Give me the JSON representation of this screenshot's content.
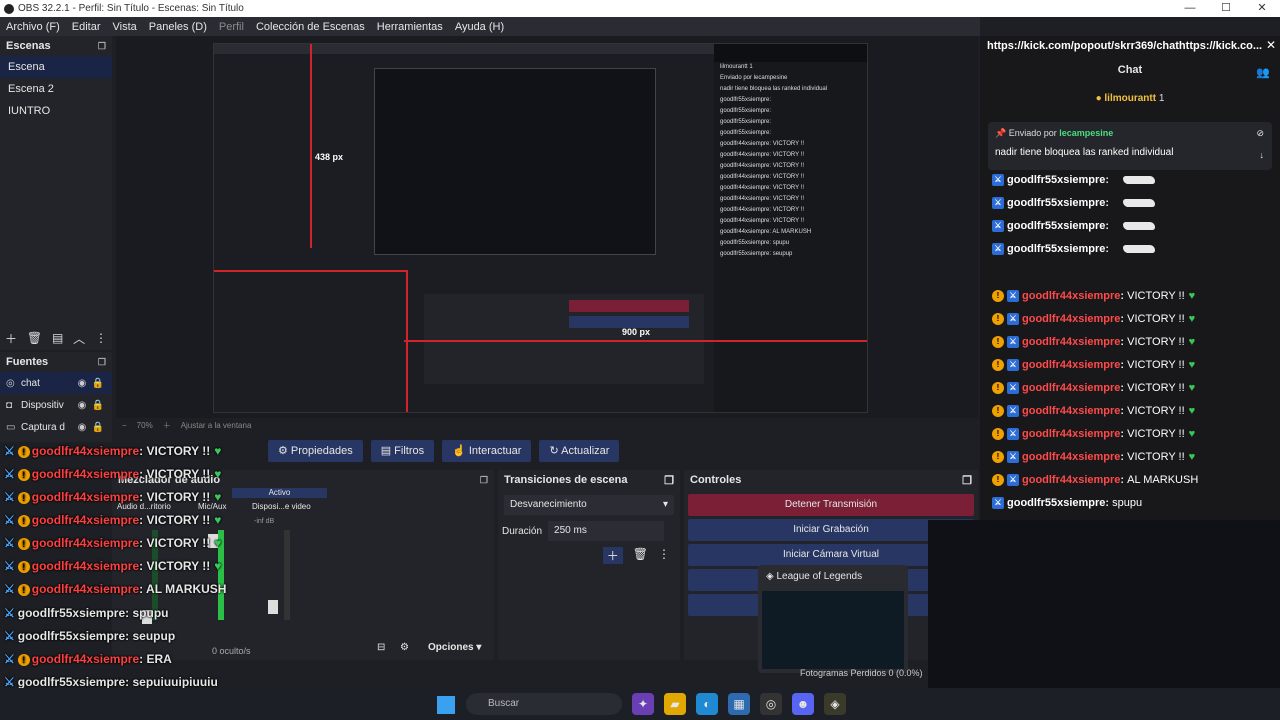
{
  "window": {
    "title": "OBS 32.2.1 - Perfil: Sin Título - Escenas: Sin Título",
    "min": "—",
    "max": "☐",
    "close": "✕"
  },
  "menu": [
    "Archivo (F)",
    "Editar",
    "Vista",
    "Paneles (D)",
    "Perfil",
    "Colección de Escenas",
    "Herramientas",
    "Ayuda (H)"
  ],
  "scenes": {
    "title": "Escenas",
    "items": [
      "Escena",
      "Escena 2",
      "IUNTRO"
    ]
  },
  "sources": {
    "title": "Fuentes",
    "items": [
      {
        "icon": "chat-icon",
        "name": "chat"
      },
      {
        "icon": "camera-icon",
        "name": "Dispositiv"
      },
      {
        "icon": "capture-icon",
        "name": "Captura d"
      }
    ]
  },
  "preview": {
    "label_438": "438 px",
    "label_900": "900 px",
    "zoom": "70%",
    "fit": "Ajustar a la ventana"
  },
  "inner_chat_lines": [
    "lilmourantt 1",
    "Enviado por lecampesine",
    "nadir tiene bloquea las ranked individual",
    "goodlfr55xsiempre:",
    "goodlfr55xsiempre:",
    "goodlfr55xsiempre:",
    "goodlfr55xsiempre:",
    "goodlfr44xsiempre: VICTORY !!",
    "goodlfr44xsiempre: VICTORY !!",
    "goodlfr44xsiempre: VICTORY !!",
    "goodlfr44xsiempre: VICTORY !!",
    "goodlfr44xsiempre: VICTORY !!",
    "goodlfr44xsiempre: VICTORY !!",
    "goodlfr44xsiempre: VICTORY !!",
    "goodlfr44xsiempre: VICTORY !!",
    "goodlfr44xsiempre: AL MARKUSH",
    "goodlfr55xsiempre: spupu",
    "goodlfr55xsiempre: seupup"
  ],
  "toolbar": {
    "properties": "Propiedades",
    "filters": "Filtros",
    "interact": "Interactuar",
    "update": "Actualizar"
  },
  "mixer": {
    "title": "Mezclador de audio",
    "active": "Activo",
    "ch1": "Audio d...ritorio",
    "ch2": "Mic/Aux",
    "ch3": "Disposi...e video",
    "inf": "-inf dB",
    "hidden": "0 oculto/s",
    "options": "Opciones"
  },
  "transitions": {
    "title": "Transiciones de escena",
    "selected": "Desvanecimiento",
    "duration_label": "Duración",
    "duration": "250 ms"
  },
  "controls": {
    "title": "Controles",
    "stop_stream": "Detener Transmisión",
    "start_rec": "Iniciar Grabación",
    "virtual_cam": "Iniciar Cámara Virtual"
  },
  "popup": {
    "title": "League of Legends"
  },
  "frames": "Fotogramas Perdidos 0 (0.0%)",
  "overlay_chat": [
    {
      "user": "goodlfr44xsiempre",
      "msg": "VICTORY !!",
      "red": true,
      "heart": true,
      "badge": true
    },
    {
      "user": "goodlfr44xsiempre",
      "msg": "VICTORY !!",
      "red": true,
      "heart": true,
      "badge": true
    },
    {
      "user": "goodlfr44xsiempre",
      "msg": "VICTORY !!",
      "red": true,
      "heart": true,
      "badge": true
    },
    {
      "user": "goodlfr44xsiempre",
      "msg": "VICTORY !!",
      "red": true,
      "heart": true,
      "badge": true
    },
    {
      "user": "goodlfr44xsiempre",
      "msg": "VICTORY !!",
      "red": true,
      "heart": true,
      "badge": true
    },
    {
      "user": "goodlfr44xsiempre",
      "msg": "VICTORY !!",
      "red": true,
      "heart": true,
      "badge": true
    },
    {
      "user": "goodlfr44xsiempre",
      "msg": "AL MARKUSH",
      "red": true,
      "heart": false,
      "badge": true
    },
    {
      "user": "goodlfr55xsiempre",
      "msg": "spupu",
      "red": false,
      "heart": false,
      "badge": false
    },
    {
      "user": "goodlfr55xsiempre",
      "msg": "seupup",
      "red": false,
      "heart": false,
      "badge": false
    },
    {
      "user": "goodlfr44xsiempre",
      "msg": "ERA",
      "red": true,
      "heart": false,
      "badge": true
    },
    {
      "user": "goodlfr55xsiempre",
      "msg": "sepuiuuipiuuiu",
      "red": false,
      "heart": false,
      "badge": false
    }
  ],
  "chat_panel": {
    "url": "https://kick.com/popout/skrr369/chathttps://kick.co...",
    "title": "Chat",
    "top_user": "lilmourantt",
    "top_count": "1",
    "pinned_by": "Enviado por",
    "pinned_user": "lecampesine",
    "pinned_msg": "nadir tiene bloquea las ranked individual",
    "messages": [
      {
        "user": "goodlfr55xsiempre",
        "msg": "",
        "red": false,
        "goose": true
      },
      {
        "user": "goodlfr55xsiempre",
        "msg": "",
        "red": false,
        "goose": true
      },
      {
        "user": "goodlfr55xsiempre",
        "msg": "",
        "red": false,
        "goose": true
      },
      {
        "user": "goodlfr55xsiempre",
        "msg": "",
        "red": false,
        "goose": true
      },
      {
        "user": "goodlfr44xsiempre",
        "msg": "VICTORY !!",
        "red": true,
        "heart": true
      },
      {
        "user": "goodlfr44xsiempre",
        "msg": "VICTORY !!",
        "red": true,
        "heart": true
      },
      {
        "user": "goodlfr44xsiempre",
        "msg": "VICTORY !!",
        "red": true,
        "heart": true
      },
      {
        "user": "goodlfr44xsiempre",
        "msg": "VICTORY !!",
        "red": true,
        "heart": true
      },
      {
        "user": "goodlfr44xsiempre",
        "msg": "VICTORY !!",
        "red": true,
        "heart": true
      },
      {
        "user": "goodlfr44xsiempre",
        "msg": "VICTORY !!",
        "red": true,
        "heart": true
      },
      {
        "user": "goodlfr44xsiempre",
        "msg": "VICTORY !!",
        "red": true,
        "heart": true
      },
      {
        "user": "goodlfr44xsiempre",
        "msg": "VICTORY !!",
        "red": true,
        "heart": true
      },
      {
        "user": "goodlfr44xsiempre",
        "msg": "AL MARKUSH",
        "red": true,
        "heart": false
      },
      {
        "user": "goodlfr55xsiempre",
        "msg": "spupu",
        "red": false
      },
      {
        "user": "goodlfr55xsiempre",
        "msg": "seupup",
        "red": false
      }
    ]
  },
  "taskbar": {
    "search": "Buscar"
  },
  "colors": {
    "accent_blue": "#283664",
    "stop_red": "#7a1f36",
    "outline_red": "#d2232a",
    "chat_red": "#ff4a4a",
    "heart_green": "#38c85a"
  }
}
